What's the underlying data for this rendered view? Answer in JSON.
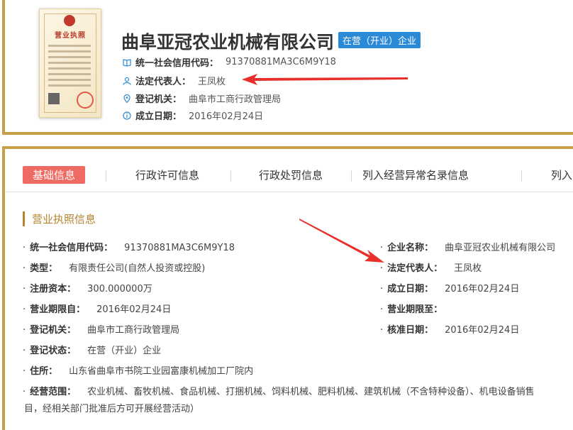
{
  "company": {
    "name": "曲阜亚冠农业机械有限公司",
    "status": "在营（开业）企业",
    "credit_code_label": "统一社会信用代码：",
    "credit_code": "91370881MA3C6M9Y18",
    "legal_rep_label": "法定代表人：",
    "legal_rep": "王凤枚",
    "registry_label": "登记机关：",
    "registry": "曲阜市工商行政管理局",
    "founded_label": "成立日期：",
    "founded": "2016年02月24日"
  },
  "license_image": {
    "title": "营业执照"
  },
  "tabs": [
    {
      "label": "基础信息",
      "active": true
    },
    {
      "label": "行政许可信息"
    },
    {
      "label": "行政处罚信息"
    },
    {
      "label": "列入经营异常名录信息"
    },
    {
      "label": "列入"
    }
  ],
  "section": {
    "title": "营业执照信息"
  },
  "fields": {
    "credit_code": {
      "label": "统一社会信用代码：",
      "value": "91370881MA3C6M9Y18"
    },
    "type": {
      "label": "类型：",
      "value": "有限责任公司(自然人投资或控股)"
    },
    "capital": {
      "label": "注册资本：",
      "value": "300.000000万"
    },
    "term_from": {
      "label": "营业期限自：",
      "value": "2016年02月24日"
    },
    "authority": {
      "label": "登记机关：",
      "value": "曲阜市工商行政管理局"
    },
    "reg_status": {
      "label": "登记状态：",
      "value": "在营（开业）企业"
    },
    "address": {
      "label": "住所：",
      "value": "山东省曲阜市书院工业园富康机械加工厂院内"
    },
    "scope": {
      "label": "经营范围：",
      "value": "农业机械、畜牧机械、食品机械、打捆机械、饲料机械、肥料机械、建筑机械（不含特种设备）、机电设备销售",
      "line2": "目，经相关部门批准后方可开展经营活动）"
    },
    "name": {
      "label": "企业名称：",
      "value": "曲阜亚冠农业机械有限公司"
    },
    "legal_rep": {
      "label": "法定代表人：",
      "value": "王凤枚"
    },
    "founded": {
      "label": "成立日期：",
      "value": "2016年02月24日"
    },
    "term_to": {
      "label": "营业期限至：",
      "value": ""
    },
    "approved": {
      "label": "核准日期：",
      "value": "2016年02月24日"
    }
  },
  "colors": {
    "accent": "#c9a04a",
    "tab_active": "#ef6a63",
    "badge": "#2a8ad7",
    "arrow": "#e8302b"
  },
  "icons": [
    "book-icon",
    "user-icon",
    "location-icon",
    "info-icon"
  ]
}
